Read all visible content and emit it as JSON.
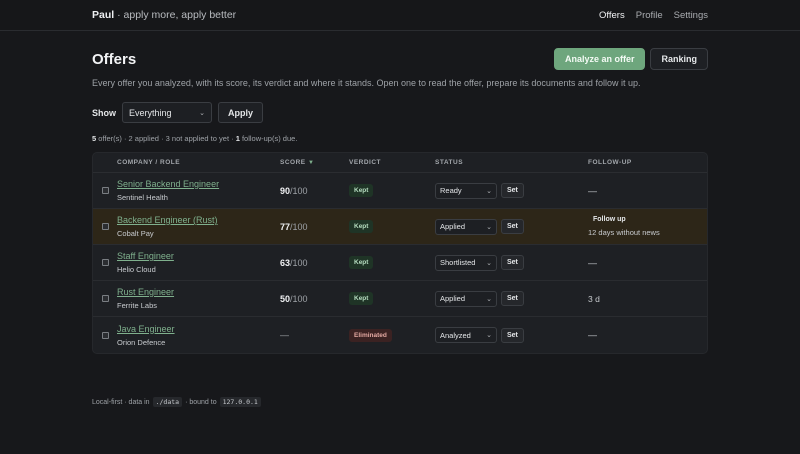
{
  "brand": {
    "name": "Paul",
    "tagline": " · apply more, apply better"
  },
  "nav": [
    {
      "label": "Offers",
      "active": true
    },
    {
      "label": "Profile",
      "active": false
    },
    {
      "label": "Settings",
      "active": false
    }
  ],
  "page": {
    "title": "Offers",
    "analyze_label": "Analyze an offer",
    "ranking_label": "Ranking",
    "description": "Every offer you analyzed, with its score, its verdict and where it stands. Open one to read the offer, prepare its documents and follow it up."
  },
  "filter": {
    "label": "Show",
    "selected": "Everything",
    "apply_label": "Apply"
  },
  "summary": {
    "count": "5",
    "text1": " offer(s) · 2 applied · 3 not applied to yet · ",
    "followups": "1",
    "text2": " follow-up(s) due."
  },
  "table": {
    "headers": {
      "company": "COMPANY / ROLE",
      "score": "SCORE",
      "verdict": "VERDICT",
      "status": "STATUS",
      "followup": "FOLLOW-UP"
    },
    "sort_icon": "▼",
    "set_label": "Set",
    "rows": [
      {
        "role": "Senior Backend Engineer",
        "company": "Sentinel Health",
        "score": "90",
        "score_max": "/100",
        "verdict": "Kept",
        "status": "Ready",
        "followup": "—"
      },
      {
        "role": "Backend Engineer (Rust)",
        "company": "Cobalt Pay",
        "score": "77",
        "score_max": "/100",
        "verdict": "Kept",
        "status": "Applied",
        "followup_title": "Follow up",
        "followup_sub": "12 days without news"
      },
      {
        "role": "Staff Engineer",
        "company": "Helio Cloud",
        "score": "63",
        "score_max": "/100",
        "verdict": "Kept",
        "status": "Shortlisted",
        "followup": "—"
      },
      {
        "role": "Rust Engineer",
        "company": "Ferrite Labs",
        "score": "50",
        "score_max": "/100",
        "verdict": "Kept",
        "status": "Applied",
        "followup": "3 d"
      },
      {
        "role": "Java Engineer",
        "company": "Orion Defence",
        "score": "—",
        "verdict": "Eliminated",
        "status": "Analyzed",
        "followup": "—"
      }
    ]
  },
  "footer": {
    "text1": "Local-first · data in",
    "path": "./data",
    "text2": "· bound to",
    "host": "127.0.0.1"
  },
  "colors": {
    "accent": "#6ea67d",
    "kept": "#1f3426",
    "eliminated": "#3b2222",
    "highlight_row": "#2d2618"
  }
}
